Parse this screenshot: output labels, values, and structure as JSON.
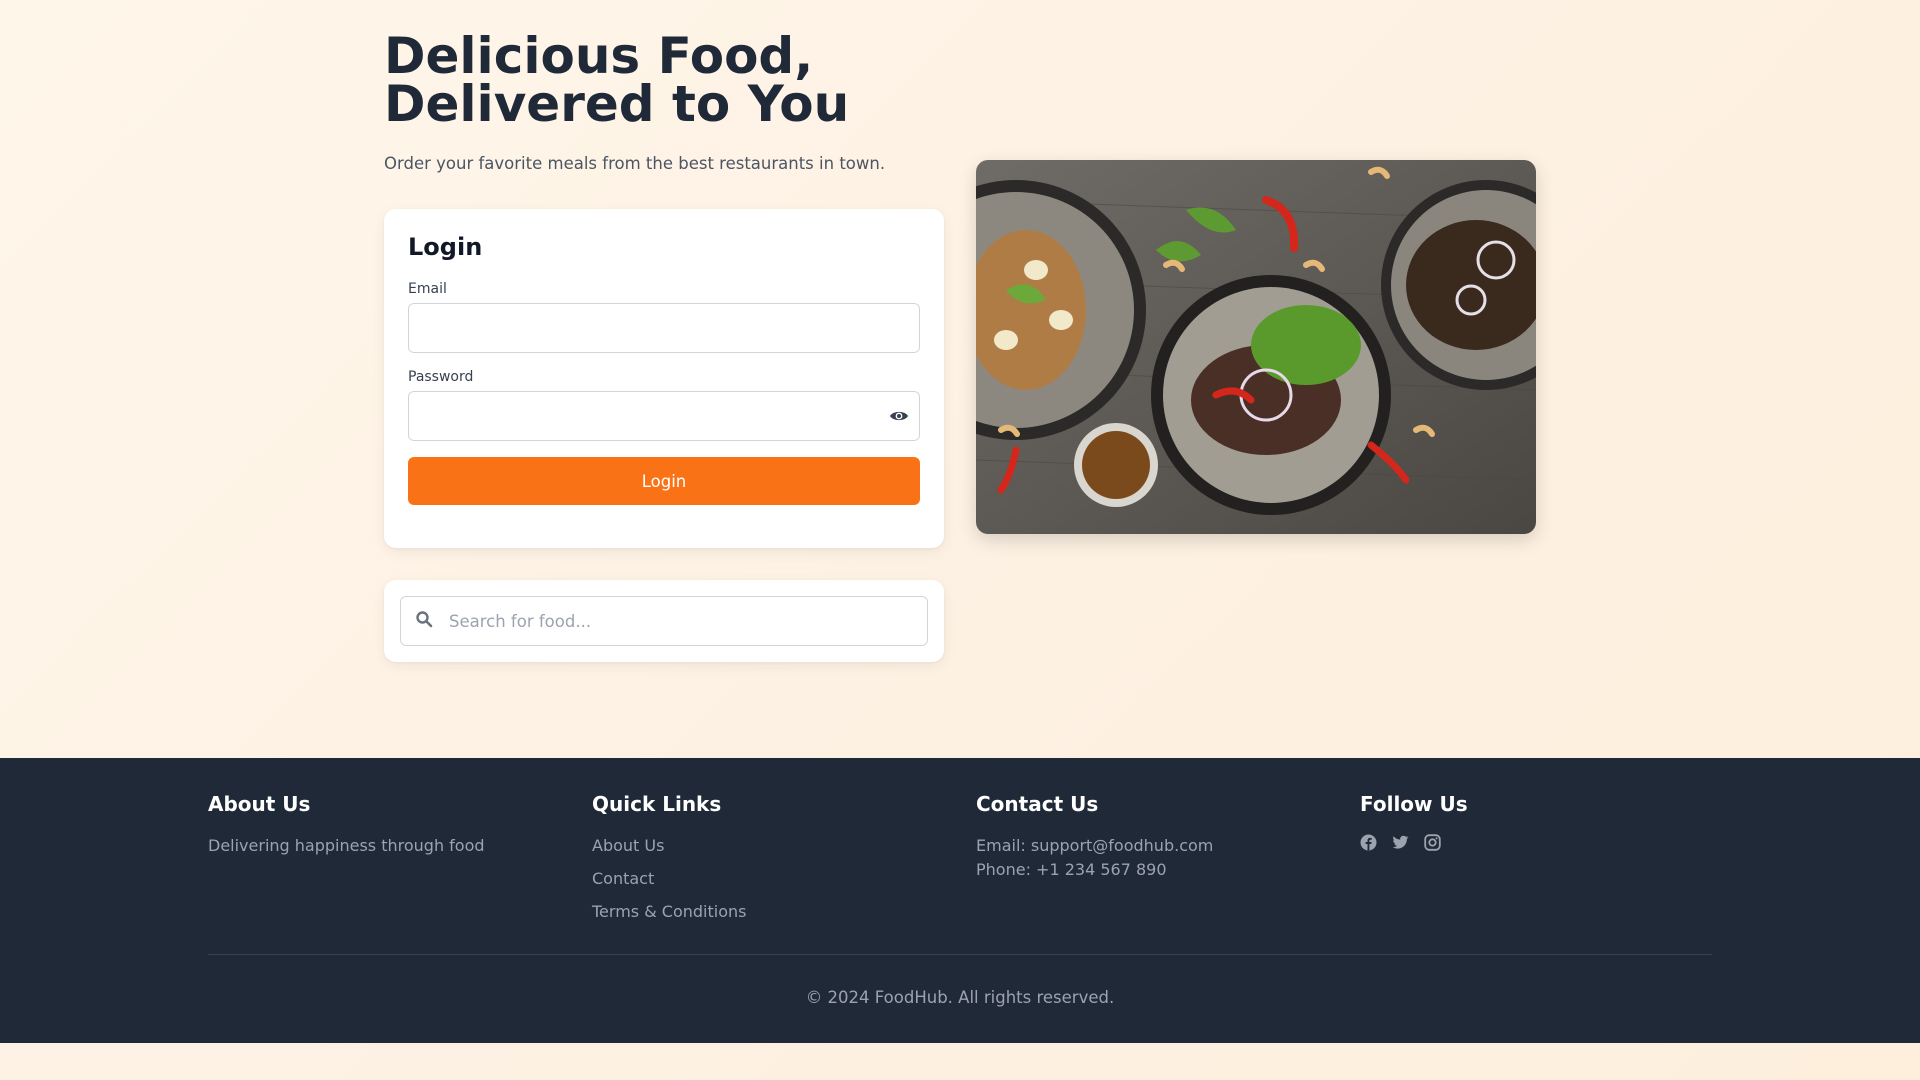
{
  "hero": {
    "title_line1": "Delicious Food,",
    "title_line2": "Delivered to You",
    "subtitle": "Order your favorite meals from the best restaurants in town."
  },
  "login": {
    "title": "Login",
    "email_label": "Email",
    "email_value": "",
    "password_label": "Password",
    "password_value": "",
    "show_password_icon": "eye-icon",
    "submit_label": "Login"
  },
  "search": {
    "icon": "search-icon",
    "placeholder": "Search for food..."
  },
  "footer": {
    "about": {
      "heading": "About Us",
      "text": "Delivering happiness through food"
    },
    "quick_links": {
      "heading": "Quick Links",
      "items": [
        "About Us",
        "Contact",
        "Terms & Conditions"
      ]
    },
    "contact": {
      "heading": "Contact Us",
      "email": "Email: support@foodhub.com",
      "phone": "Phone: +1 234 567 890"
    },
    "follow": {
      "heading": "Follow Us",
      "icons": [
        "facebook-icon",
        "twitter-icon",
        "instagram-icon"
      ]
    },
    "copyright": "© 2024 FoodHub. All rights reserved."
  },
  "colors": {
    "accent": "#f97316",
    "footer_bg": "#1f2937",
    "page_bg": "#fff6ea"
  }
}
